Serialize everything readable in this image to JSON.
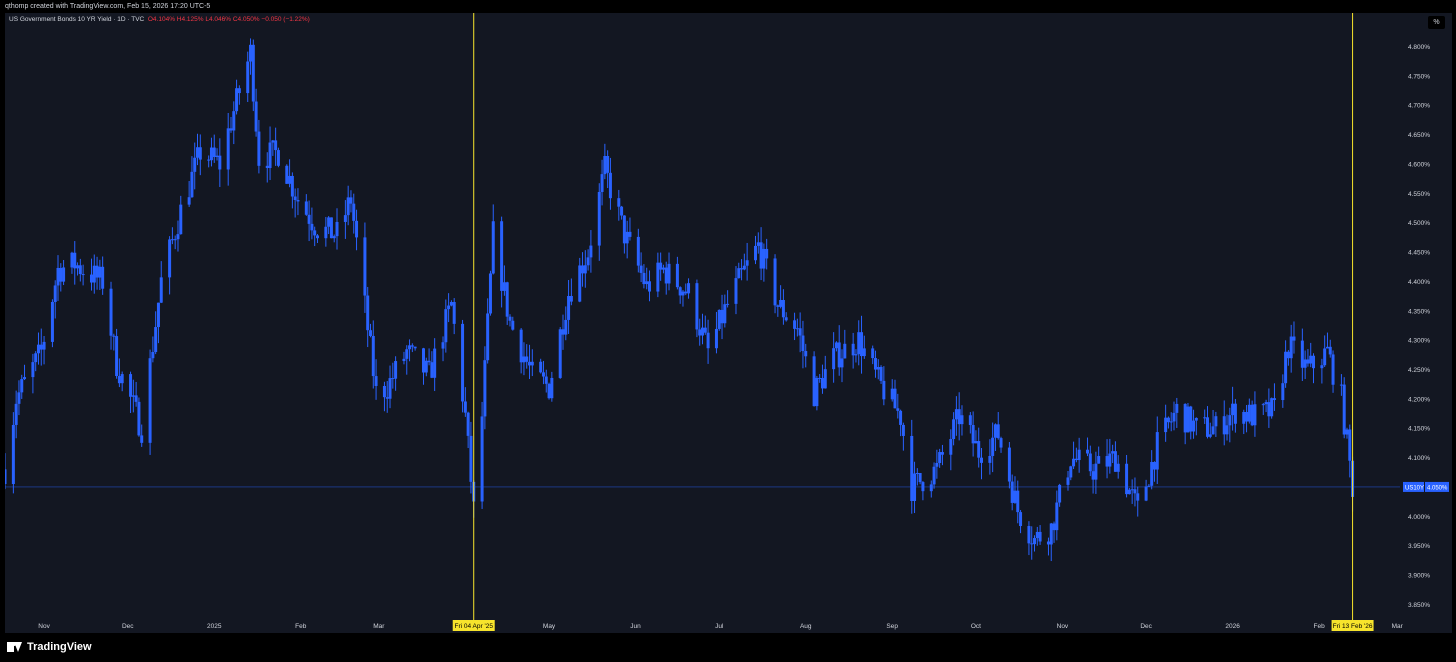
{
  "header": {
    "attribution": "qthomp created with TradingView.com, Feb 15, 2026 17:20 UTC-5"
  },
  "legend": {
    "symbol": "US Government Bonds 10 YR Yield · 1D · TVC",
    "open": "O4.104%",
    "high": "H4.125%",
    "low": "L4.046%",
    "close": "C4.050%",
    "change": "−0.050 (−1.22%)"
  },
  "unit_button": "%",
  "footer": {
    "brand": "TradingView"
  },
  "colors": {
    "candle": "#2962ff",
    "background": "#131722",
    "marker": "#f7e42c",
    "price_line": "#2962ff",
    "text": "#d1d4dc"
  },
  "chart_data": {
    "type": "candlestick",
    "title": "US Government Bonds 10 YR Yield · 1D · TVC",
    "y_unit": "%",
    "ylim": [
      3.82,
      4.84
    ],
    "y_ticks": [
      "4.800%",
      "4.750%",
      "4.700%",
      "4.650%",
      "4.600%",
      "4.550%",
      "4.500%",
      "4.450%",
      "4.400%",
      "4.350%",
      "4.300%",
      "4.250%",
      "4.200%",
      "4.150%",
      "4.100%",
      "4.000%",
      "3.950%",
      "3.900%",
      "3.850%"
    ],
    "x_ticks": [
      "Nov",
      "Dec",
      "2025",
      "Feb",
      "Mar",
      "May",
      "Jun",
      "Jul",
      "Aug",
      "Sep",
      "Oct",
      "Nov",
      "Dec",
      "2026",
      "Feb",
      "Mar"
    ],
    "x_range": [
      "2024-10-18",
      "2026-03-02"
    ],
    "markers": [
      {
        "date": "2025-04-04",
        "label": "Fri 04 Apr '25"
      },
      {
        "date": "2026-02-13",
        "label": "Fri 13 Feb '26"
      }
    ],
    "last_price": {
      "label": "US10Y",
      "value": 4.05,
      "text": "4.050%"
    },
    "series": [
      {
        "name": "US10Y",
        "anchors": [
          [
            "2024-10-18",
            4.08
          ],
          [
            "2024-10-22",
            4.2
          ],
          [
            "2024-10-31",
            4.28
          ],
          [
            "2024-11-06",
            4.42
          ],
          [
            "2024-11-12",
            4.43
          ],
          [
            "2024-11-15",
            4.42
          ],
          [
            "2024-11-22",
            4.4
          ],
          [
            "2024-11-27",
            4.26
          ],
          [
            "2024-12-06",
            4.15
          ],
          [
            "2024-12-13",
            4.4
          ],
          [
            "2024-12-20",
            4.52
          ],
          [
            "2024-12-27",
            4.62
          ],
          [
            "2025-01-03",
            4.6
          ],
          [
            "2025-01-08",
            4.69
          ],
          [
            "2025-01-14",
            4.79
          ],
          [
            "2025-01-17",
            4.61
          ],
          [
            "2025-01-24",
            4.62
          ],
          [
            "2025-01-31",
            4.54
          ],
          [
            "2025-02-07",
            4.49
          ],
          [
            "2025-02-14",
            4.48
          ],
          [
            "2025-02-19",
            4.54
          ],
          [
            "2025-02-28",
            4.21
          ],
          [
            "2025-03-04",
            4.22
          ],
          [
            "2025-03-11",
            4.28
          ],
          [
            "2025-03-19",
            4.24
          ],
          [
            "2025-03-27",
            4.36
          ],
          [
            "2025-04-01",
            4.17
          ],
          [
            "2025-04-04",
            4.01
          ],
          [
            "2025-04-07",
            4.17
          ],
          [
            "2025-04-11",
            4.48
          ],
          [
            "2025-04-17",
            4.33
          ],
          [
            "2025-04-25",
            4.24
          ],
          [
            "2025-05-01",
            4.22
          ],
          [
            "2025-05-08",
            4.38
          ],
          [
            "2025-05-15",
            4.45
          ],
          [
            "2025-05-21",
            4.59
          ],
          [
            "2025-05-28",
            4.48
          ],
          [
            "2025-06-05",
            4.39
          ],
          [
            "2025-06-11",
            4.42
          ],
          [
            "2025-06-20",
            4.38
          ],
          [
            "2025-06-27",
            4.28
          ],
          [
            "2025-07-03",
            4.35
          ],
          [
            "2025-07-08",
            4.4
          ],
          [
            "2025-07-15",
            4.46
          ],
          [
            "2025-07-22",
            4.36
          ],
          [
            "2025-07-29",
            4.32
          ],
          [
            "2025-08-04",
            4.21
          ],
          [
            "2025-08-11",
            4.27
          ],
          [
            "2025-08-20",
            4.3
          ],
          [
            "2025-08-27",
            4.23
          ],
          [
            "2025-09-04",
            4.17
          ],
          [
            "2025-09-08",
            4.05
          ],
          [
            "2025-09-17",
            4.08
          ],
          [
            "2025-09-25",
            4.17
          ],
          [
            "2025-10-02",
            4.11
          ],
          [
            "2025-10-09",
            4.14
          ],
          [
            "2025-10-16",
            4.01
          ],
          [
            "2025-10-22",
            3.96
          ],
          [
            "2025-10-28",
            3.98
          ],
          [
            "2025-11-04",
            4.1
          ],
          [
            "2025-11-12",
            4.08
          ],
          [
            "2025-11-20",
            4.1
          ],
          [
            "2025-11-28",
            4.01
          ],
          [
            "2025-12-05",
            4.12
          ],
          [
            "2025-12-12",
            4.18
          ],
          [
            "2025-12-19",
            4.15
          ],
          [
            "2025-12-26",
            4.15
          ],
          [
            "2026-01-02",
            4.18
          ],
          [
            "2026-01-09",
            4.17
          ],
          [
            "2026-01-16",
            4.18
          ],
          [
            "2026-01-21",
            4.29
          ],
          [
            "2026-01-28",
            4.25
          ],
          [
            "2026-02-04",
            4.28
          ],
          [
            "2026-02-09",
            4.2
          ],
          [
            "2026-02-13",
            4.05
          ]
        ]
      }
    ]
  }
}
